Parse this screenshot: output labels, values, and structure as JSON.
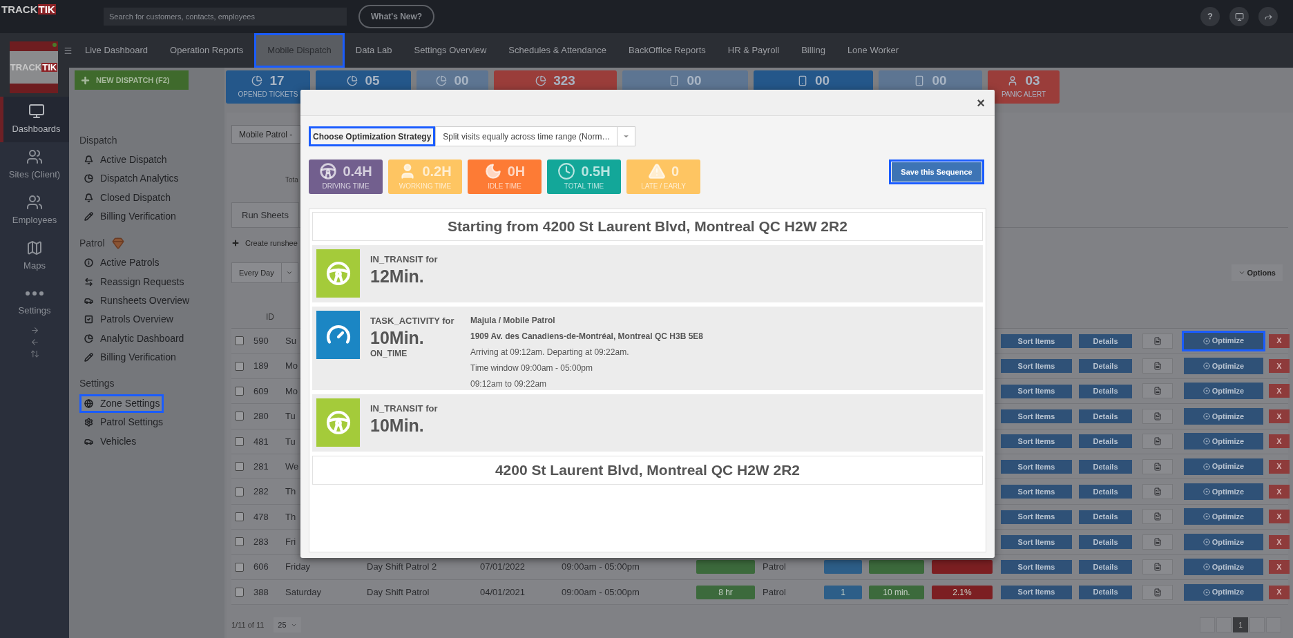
{
  "top_bar": {
    "logo": {
      "text": "TRACK",
      "accent": "TIK"
    },
    "search": {
      "placeholder": "Search for customers, contacts, employees"
    },
    "whats_new": "What's New?",
    "help": "?"
  },
  "nav": {
    "logo": {
      "text": "TRACK",
      "accent": "TIK"
    },
    "items": [
      {
        "label": "Live Dashboard",
        "selected": false
      },
      {
        "label": "Operation Reports",
        "selected": false
      },
      {
        "label": "Mobile Dispatch",
        "selected": true
      },
      {
        "label": "Data Lab",
        "selected": false
      },
      {
        "label": "Settings Overview",
        "selected": false
      },
      {
        "label": "Schedules & Attendance",
        "selected": false
      },
      {
        "label": "BackOffice Reports",
        "selected": false
      },
      {
        "label": "HR & Payroll",
        "selected": false
      },
      {
        "label": "Billing",
        "selected": false
      },
      {
        "label": "Lone Worker",
        "selected": false
      }
    ]
  },
  "rail": [
    {
      "label": "Dashboards",
      "kind": "monitor",
      "selected": true
    },
    {
      "label": "Sites (Client)",
      "kind": "group",
      "selected": false
    },
    {
      "label": "Employees",
      "kind": "group",
      "selected": false
    },
    {
      "label": "Maps",
      "kind": "map",
      "selected": false
    },
    {
      "label": "Settings",
      "kind": "dots",
      "selected": false
    }
  ],
  "new_dispatch": "NEW DISPATCH (F2)",
  "menu": [
    {
      "heading": "Dispatch",
      "items": [
        {
          "label": "Active Dispatch",
          "kind": "bell",
          "selected": false
        },
        {
          "label": "Dispatch Analytics",
          "kind": "pie",
          "selected": false
        },
        {
          "label": "Closed Dispatch",
          "kind": "bell",
          "selected": false
        },
        {
          "label": "Billing Verification",
          "kind": "pencil",
          "selected": false
        }
      ]
    },
    {
      "heading": "Patrol",
      "gem": true,
      "items": [
        {
          "label": "Active Patrols",
          "kind": "info",
          "selected": false
        },
        {
          "label": "Reassign Requests",
          "kind": "swap",
          "selected": false
        },
        {
          "label": "Runsheets Overview",
          "kind": "car",
          "selected": false
        },
        {
          "label": "Patrols Overview",
          "kind": "check",
          "selected": false
        },
        {
          "label": "Analytic Dashboard",
          "kind": "pie",
          "selected": false
        },
        {
          "label": "Billing Verification",
          "kind": "pencil",
          "selected": false
        }
      ]
    },
    {
      "heading": "Settings",
      "items": [
        {
          "label": "Zone Settings",
          "kind": "globe",
          "selected": true
        },
        {
          "label": "Patrol Settings",
          "kind": "gear",
          "selected": false
        },
        {
          "label": "Vehicles",
          "kind": "car",
          "selected": false
        }
      ]
    }
  ],
  "tiles": [
    {
      "value": "17",
      "label": "OPENED TICKETS",
      "kind": "pie",
      "color": "#24578a"
    },
    {
      "value": "05",
      "kind": "pie",
      "color": "#24578a"
    },
    {
      "value": "00",
      "kind": "pie",
      "color": "#5d7592"
    },
    {
      "value": "323",
      "kind": "pie",
      "color": "#9a3d3a"
    },
    {
      "value": "00",
      "kind": "phone",
      "color": "#5d7592"
    },
    {
      "value": "00",
      "kind": "phone",
      "color": "#24578a"
    },
    {
      "value": "00",
      "kind": "phone",
      "color": "#5d7592"
    },
    {
      "value": "03",
      "label": "PANIC ALERT",
      "kind": "person",
      "color": "#9a3d3a"
    }
  ],
  "content": {
    "patrol_select": "Mobile Patrol -",
    "summary_fragment": "Tota",
    "tabs": [
      {
        "label": "Run Sheets",
        "selected": true
      }
    ],
    "create": "Create runshee",
    "day_filter": "Every Day",
    "options": "Options",
    "columns": [
      "ID"
    ],
    "rows": [
      {
        "kind": "partial",
        "checked": false,
        "id": "590",
        "day": "Su",
        "sort": "Sort Items",
        "details": "Details",
        "optimize": "Optimize",
        "delete": "X",
        "highlighted": true
      },
      {
        "kind": "partial",
        "checked": false,
        "id": "189",
        "day": "Mo",
        "sort": "Sort Items",
        "details": "Details",
        "optimize": "Optimize",
        "delete": "X",
        "highlighted": false
      },
      {
        "kind": "partial",
        "checked": false,
        "id": "609",
        "day": "Mo",
        "sort": "Sort Items",
        "details": "Details",
        "optimize": "Optimize",
        "delete": "X",
        "highlighted": false
      },
      {
        "kind": "partial",
        "checked": false,
        "id": "280",
        "day": "Tu",
        "sort": "Sort Items",
        "details": "Details",
        "optimize": "Optimize",
        "delete": "X",
        "highlighted": false
      },
      {
        "kind": "partial",
        "checked": false,
        "id": "481",
        "day": "Tu",
        "sort": "Sort Items",
        "details": "Details",
        "optimize": "Optimize",
        "delete": "X",
        "highlighted": false
      },
      {
        "kind": "partial",
        "checked": false,
        "id": "281",
        "day": "We",
        "sort": "Sort Items",
        "details": "Details",
        "optimize": "Optimize",
        "delete": "X",
        "highlighted": false
      },
      {
        "kind": "partial",
        "checked": false,
        "id": "282",
        "day": "Th",
        "sort": "Sort Items",
        "details": "Details",
        "optimize": "Optimize",
        "delete": "X",
        "highlighted": false
      },
      {
        "kind": "partial",
        "checked": false,
        "id": "478",
        "day": "Th",
        "sort": "Sort Items",
        "details": "Details",
        "optimize": "Optimize",
        "delete": "X",
        "highlighted": false
      },
      {
        "kind": "partial",
        "checked": false,
        "id": "283",
        "day": "Fri",
        "sort": "Sort Items",
        "details": "Details",
        "optimize": "Optimize",
        "delete": "X",
        "highlighted": false
      },
      {
        "kind": "full",
        "checked": false,
        "id": "606",
        "day": "Friday",
        "name": "Day Shift Patrol 2",
        "date": "07/01/2022",
        "time": "09:00am - 05:00pm",
        "type": "Patrol",
        "sort": "Sort Items",
        "details": "Details",
        "optimize": "Optimize",
        "delete": "X",
        "highlighted": false
      },
      {
        "kind": "full",
        "checked": false,
        "id": "388",
        "day": "Saturday",
        "name": "Day Shift Patrol",
        "date": "04/01/2021",
        "time": "09:00am - 05:00pm",
        "hours": "8 hr",
        "type": "Patrol",
        "count": "1",
        "duration": "10 min.",
        "percent": "2.1%",
        "sort": "Sort Items",
        "details": "Details",
        "optimize": "Optimize",
        "delete": "X",
        "highlighted": false
      }
    ],
    "pagination": {
      "summary": "1/11 of 11",
      "page_size": "25",
      "pages": [
        {
          "label": "1",
          "selected": true
        }
      ]
    }
  },
  "modal": {
    "close": "×",
    "strategy": {
      "label": "Choose Optimization Strategy",
      "value": "Split visits equally across time range (Norm…"
    },
    "stats": [
      {
        "value": "0.4H",
        "label": "DRIVING TIME",
        "kind": "wheel",
        "color": "#725f8e"
      },
      {
        "value": "0.2H",
        "label": "WORKING TIME",
        "kind": "person",
        "color": "#fec562"
      },
      {
        "value": "0H",
        "label": "IDLE TIME",
        "kind": "moon",
        "color": "#fd7b35"
      },
      {
        "value": "0.5H",
        "label": "TOTAL TIME",
        "kind": "clock",
        "color": "#13a799"
      },
      {
        "value": "0",
        "label": "LATE / EARLY",
        "kind": "warning",
        "color": "#fec562"
      }
    ],
    "save": "Save this Sequence",
    "route": [
      {
        "kind": "address",
        "text": "Starting from 4200 St Laurent Blvd, Montreal QC H2W 2R2"
      },
      {
        "kind": "transit",
        "status": "IN_TRANSIT for",
        "duration": "12Min."
      },
      {
        "kind": "task",
        "status": "TASK_ACTIVITY for",
        "duration": "10Min.",
        "timing": "ON_TIME",
        "site": "Majula / Mobile Patrol",
        "address": "1909 Av. des Canadiens-de-Montréal, Montreal QC H3B 5E8",
        "lines": [
          "Arriving at 09:12am. Departing at 09:22am.",
          "Time window 09:00am - 05:00pm",
          "09:12am to 09:22am"
        ]
      },
      {
        "kind": "transit",
        "status": "IN_TRANSIT for",
        "duration": "10Min."
      },
      {
        "kind": "address",
        "text": "4200 St Laurent Blvd, Montreal QC H2W 2R2"
      }
    ]
  }
}
